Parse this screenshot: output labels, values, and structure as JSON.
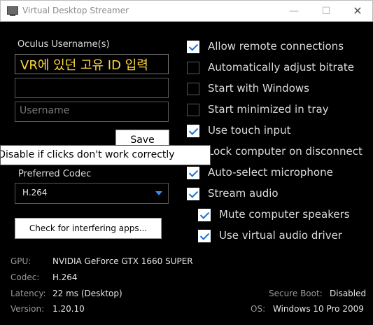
{
  "window": {
    "title": "Virtual Desktop Streamer"
  },
  "left": {
    "username_label": "Oculus Username(s)",
    "username1_value": "VR에 있던 고유 ID 입력",
    "username2_value": "",
    "username3_placeholder": "Username",
    "save_label": "Save",
    "tooltip": "res. Disable if clicks don't work correctly",
    "codec_label": "Preferred Codec",
    "codec_value": "H.264",
    "check_apps_label": "Check for interfering apps..."
  },
  "options": [
    {
      "label": "Allow remote connections",
      "checked": true
    },
    {
      "label": "Automatically adjust bitrate",
      "checked": false
    },
    {
      "label": "Start with Windows",
      "checked": false
    },
    {
      "label": "Start minimized in tray",
      "checked": false
    },
    {
      "label": "Use touch input",
      "checked": true
    },
    {
      "label": "Lock computer on disconnect",
      "checked": false
    },
    {
      "label": "Auto-select microphone",
      "checked": true
    },
    {
      "label": "Stream audio",
      "checked": true
    },
    {
      "label": "Mute computer speakers",
      "checked": true
    },
    {
      "label": "Use virtual audio driver",
      "checked": true
    }
  ],
  "info": {
    "gpu_key": "GPU:",
    "gpu_val": "NVIDIA GeForce GTX 1660 SUPER",
    "codec_key": "Codec:",
    "codec_val": "H.264",
    "latency_key": "Latency:",
    "latency_val": "22 ms (Desktop)",
    "version_key": "Version:",
    "version_val": "1.20.10",
    "secure_key": "Secure Boot:",
    "secure_val": "Disabled",
    "os_key": "OS:",
    "os_val": "Windows 10 Pro 2009"
  }
}
